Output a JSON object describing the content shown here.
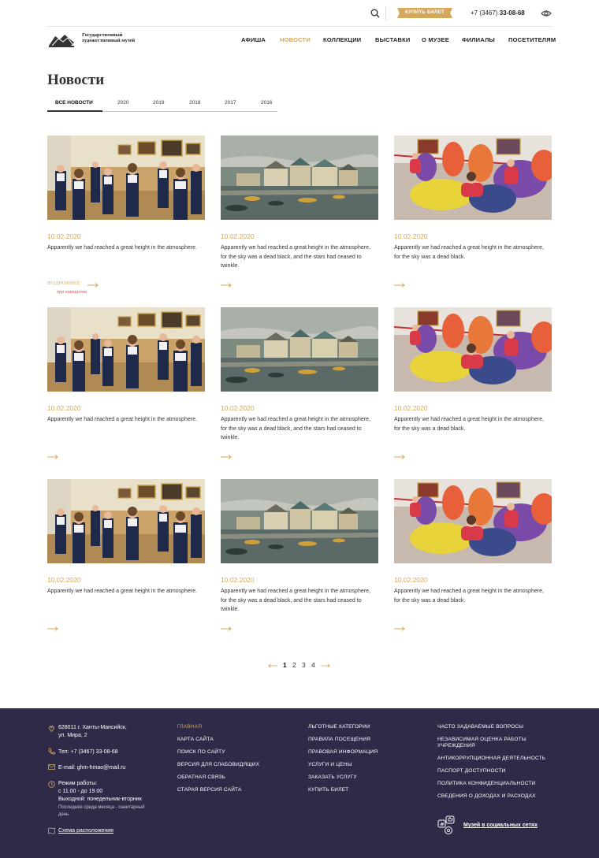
{
  "header": {
    "ticket_label": "КУПИТЬ БИЛЕТ",
    "phone_prefix": "+7 (3467) ",
    "phone_main": "33-08-68",
    "logo_text": "Государственный художественный музей",
    "nav": [
      "АФИША",
      "НОВОСТИ",
      "КОЛЛЕКЦИИ",
      "ВЫСТАВКИ",
      "О МУЗЕЕ",
      "ФИЛИАЛЫ",
      "ПОСЕТИТЕЛЯМ"
    ],
    "active_nav": "НОВОСТИ"
  },
  "page": {
    "title": "Новости",
    "tabs": [
      "ВСЕ НОВОСТИ",
      "2020",
      "2019",
      "2018",
      "2017",
      "2016"
    ],
    "active_tab": "ВСЕ НОВОСТИ"
  },
  "cards": [
    {
      "image": "children-in-gallery",
      "date": "10.02.2020",
      "text": "Apparently we had reached a great height in the atmosphere.",
      "more": "ПОДРОБНЕЕ",
      "hover": "при наведении"
    },
    {
      "image": "painting-river-town",
      "date": "10.02.2020",
      "text": "Apparently we had reached a great height in the atmosphere, for the sky was a dead black, and the stars had ceased to twinkle."
    },
    {
      "image": "kids-on-beanbags",
      "date": "10.02.2020",
      "text": "Apparently we had reached a great height in the atmosphere, for the sky was a dead black."
    },
    {
      "image": "children-in-gallery",
      "date": "10.02.2020",
      "text": "Apparently we had reached a great height in the atmosphere."
    },
    {
      "image": "painting-river-town",
      "date": "10.02.2020",
      "text": "Apparently we had reached a great height in the atmosphere, for the sky was a dead black, and the stars had ceased to twinkle."
    },
    {
      "image": "kids-on-beanbags",
      "date": "10.02.2020",
      "text": "Apparently we had reached a great height in the atmosphere, for the sky was a dead black."
    },
    {
      "image": "children-in-gallery",
      "date": "10.02.2020",
      "text": "Apparently we had reached a great height in the atmosphere."
    },
    {
      "image": "painting-river-town",
      "date": "10.02.2020",
      "text": "Apparently we had reached a great height in the atmosphere, for the sky was a dead black, and the stars had ceased to twinkle."
    },
    {
      "image": "kids-on-beanbags",
      "date": "10.02.2020",
      "text": "Apparently we had reached a great height in the atmosphere, for the sky was a dead black."
    }
  ],
  "pagination": {
    "pages": [
      "1",
      "2",
      "3",
      "4"
    ],
    "current": "1"
  },
  "footer": {
    "address_line1": "628011 г. Ханты-Мансийск,",
    "address_line2": "ул. Мира, 2",
    "phone": "Тел: +7 (3467) 33-08-68",
    "email": "E-mail: ghm-hmao@mail.ru",
    "hours_title": "Режим работы:",
    "hours": "с 11.00 - до 19.00",
    "day_off": "Выходной: понедельник-вторник",
    "sanitary_line1": "Последняя среда месяца - санитарный",
    "sanitary_line2": "день",
    "map_link": "Схема расположения",
    "col2": [
      "ГЛАВНАЯ",
      "КАРТА САЙТА",
      "ПОИСК ПО САЙТУ",
      "ВЕРСИЯ ДЛЯ СЛАБОВИДЯЩИХ",
      "ОБРАТНАЯ СВЯЗЬ",
      "СТАРАЯ ВЕРСИЯ САЙТА"
    ],
    "col3": [
      "ЛЬГОТНЫЕ КАТЕГОРИИ",
      "ПРАВИЛА ПОСЕЩЕНИЯ",
      "ПРАВОВАЯ ИНФОРМАЦИЯ",
      "УСЛУГИ И ЦЕНЫ",
      "ЗАКАЗАТЬ УСЛУГУ",
      "КУПИТЬ БИЛЕТ"
    ],
    "col4": [
      "ЧАСТО ЗАДАВАЕМЫЕ ВОПРОСЫ",
      "НЕЗАВИСИМАЯ ОЦЕНКА РАБОТЫ",
      "УЧРЕЖДЕНИЯ",
      "АНТИКОРРУПЦИОННАЯ ДЕЯТЕЛЬНОСТЬ",
      "ПАСПОРТ ДОСТУПНОСТИ",
      "ПОЛИТИКА КОНФИДЕНЦИАЛЬНОСТИ",
      "СВЕДЕНИЯ О ДОХОДАХ И РАСХОДАХ"
    ],
    "social": "Музей в социальных сетях"
  },
  "colors": {
    "accent": "#d4a75a",
    "footer_bg": "#2e2a47",
    "hover_note": "#e0564d"
  }
}
